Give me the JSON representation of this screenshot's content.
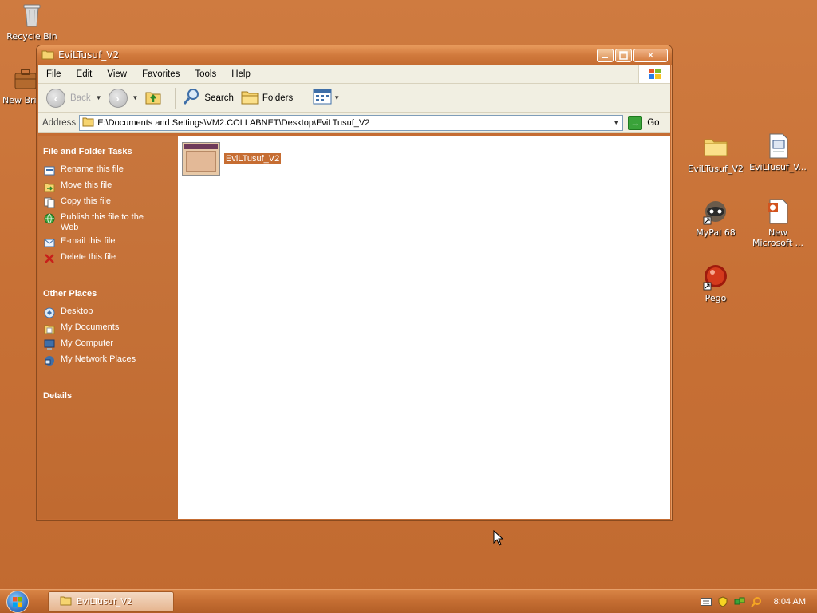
{
  "desktop": {
    "icons_left": [
      {
        "name": "recycle-bin",
        "label": "Recycle Bin"
      },
      {
        "name": "new-briefcase",
        "label": "New Bri"
      }
    ],
    "icons_right": [
      {
        "name": "eviltusuf-folder",
        "label": "EviLTusuf_V2"
      },
      {
        "name": "eviltusuf-file",
        "label": "EviLTusuf_V..."
      },
      {
        "name": "mypal",
        "label": "MyPal 68"
      },
      {
        "name": "new-microsoft",
        "label": "New Microsoft ..."
      },
      {
        "name": "pego",
        "label": "Pego"
      }
    ]
  },
  "window": {
    "title": "EviLTusuf_V2",
    "menu": [
      "File",
      "Edit",
      "View",
      "Favorites",
      "Tools",
      "Help"
    ],
    "toolbar": {
      "back": "Back",
      "search": "Search",
      "folders": "Folders"
    },
    "address": {
      "label": "Address",
      "path": "E:\\Documents and Settings\\VM2.COLLABNET\\Desktop\\EviLTusuf_V2",
      "go": "Go"
    },
    "file_tasks": {
      "title": "File and Folder Tasks",
      "items": [
        "Rename this file",
        "Move this file",
        "Copy this file",
        "Publish this file to the Web",
        "E-mail this file",
        "Delete this file"
      ]
    },
    "other_places": {
      "title": "Other Places",
      "items": [
        "Desktop",
        "My Documents",
        "My Computer",
        "My Network Places"
      ]
    },
    "details": {
      "title": "Details"
    },
    "files": [
      {
        "name": "EviLTusuf_V2"
      }
    ]
  },
  "taskbar": {
    "task": "EviLTusuf_V2",
    "clock": "8:04 AM"
  },
  "colors": {
    "desktop": "#c9733a",
    "accent": "#c56d33",
    "panel": "#f1efe2"
  }
}
